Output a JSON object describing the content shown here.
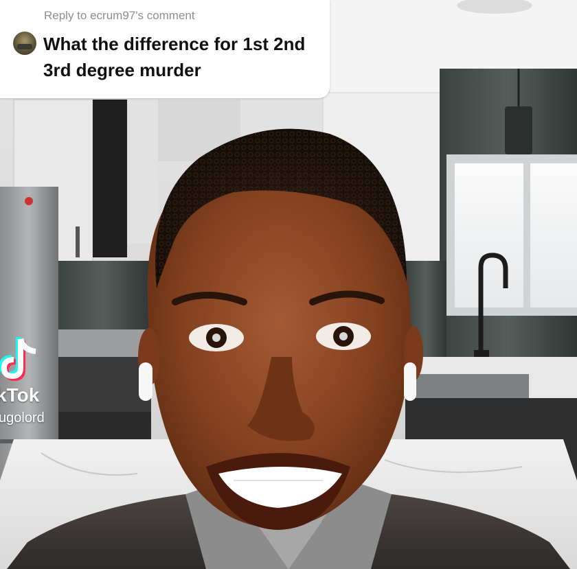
{
  "comment_card": {
    "reply_label": "Reply to ecrum97's comment",
    "text": "What the difference for 1st 2nd 3rd degree murder"
  },
  "watermark": {
    "brand": "kTok",
    "username": "ugolord"
  }
}
